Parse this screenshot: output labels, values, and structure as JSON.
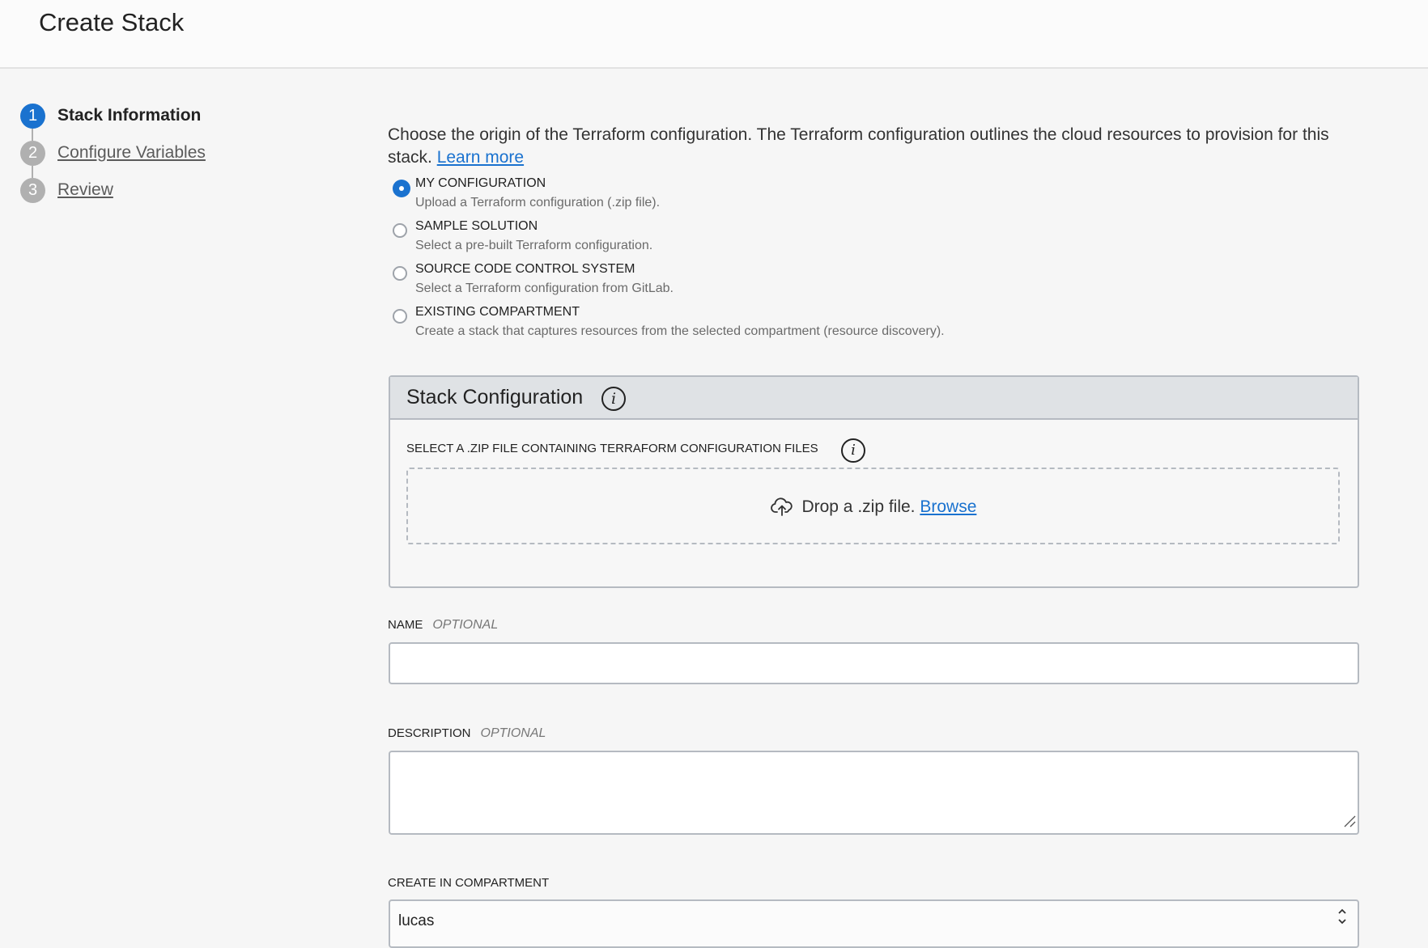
{
  "header": {
    "title": "Create Stack"
  },
  "steps": [
    {
      "number": "1",
      "label": "Stack Information",
      "active": true
    },
    {
      "number": "2",
      "label": "Configure Variables",
      "active": false
    },
    {
      "number": "3",
      "label": "Review",
      "active": false
    }
  ],
  "intro": {
    "text": "Choose the origin of the Terraform configuration. The Terraform configuration outlines the cloud resources to provision for this stack.",
    "learn_more": "Learn more"
  },
  "origin_options": [
    {
      "title": "MY CONFIGURATION",
      "description": "Upload a Terraform configuration (.zip file).",
      "selected": true
    },
    {
      "title": "SAMPLE SOLUTION",
      "description": "Select a pre-built Terraform configuration.",
      "selected": false
    },
    {
      "title": "SOURCE CODE CONTROL SYSTEM",
      "description": "Select a Terraform configuration from GitLab.",
      "selected": false
    },
    {
      "title": "EXISTING COMPARTMENT",
      "description": "Create a stack that captures resources from the selected compartment (resource discovery).",
      "selected": false
    }
  ],
  "stack_config": {
    "title": "Stack Configuration",
    "info_icon": "i",
    "zip_label": "SELECT A .ZIP FILE CONTAINING TERRAFORM CONFIGURATION FILES",
    "drop_text": "Drop a .zip file.",
    "browse": "Browse"
  },
  "name_field": {
    "label": "NAME",
    "optional": "OPTIONAL",
    "value": ""
  },
  "description_field": {
    "label": "DESCRIPTION",
    "optional": "OPTIONAL",
    "value": ""
  },
  "compartment_field": {
    "label": "CREATE IN COMPARTMENT",
    "value": "lucas",
    "arrows_up": "⌃",
    "arrows_down": "⌄"
  },
  "colors": {
    "accent": "#1a72cf",
    "border": "#b5bac1",
    "panel_header": "#dfe2e5",
    "background": "#f6f6f6"
  }
}
